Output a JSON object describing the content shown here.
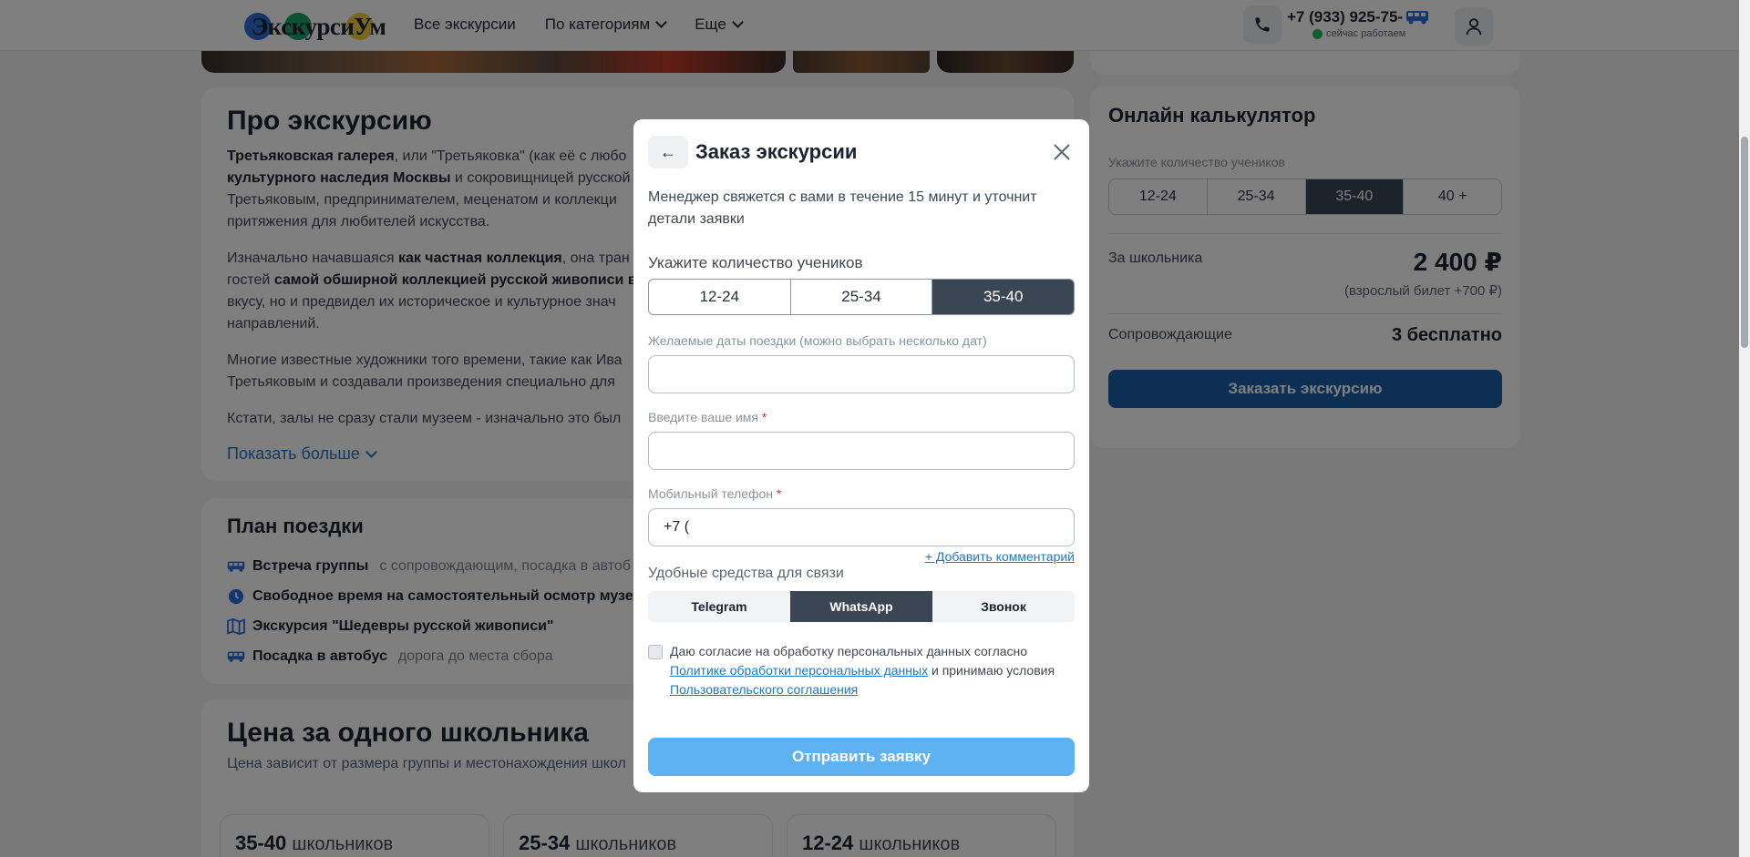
{
  "header": {
    "logo_text": "ЭкскурсиУм",
    "nav": [
      {
        "label": "Все экскурсии"
      },
      {
        "label": "По категориям"
      },
      {
        "label": "Еще"
      }
    ],
    "phone": "+7 (933) 925-75-",
    "status": "сейчас работаем"
  },
  "about": {
    "title": "Про экскурсию",
    "p1_bold": "Третьяковская галерея",
    "p1_a": ", или \"Третьяковка\" (как её с любо",
    "p1_bold2": "культурного наследия Москвы",
    "p1_b": " и сокровищницей русской",
    "p1_c": "Третьяковым, предпринимателем, меценатом и коллекци",
    "p1_d": "притяжения для любителей искусства.",
    "p2_a": "Изначально начавшаяся ",
    "p2_bold": "как частная коллекция",
    "p2_b": ", она тран",
    "p2_c": "гостей ",
    "p2_bold2": "самой обширной коллекцией русской живописи в",
    "p2_d": "вкусу, но и предвидел их историческое и культурное знач",
    "p2_e": "направлений.",
    "p3_a": "Многие известные художники того времени, такие как Ива",
    "p3_b": "Третьяковым и создавали произведения специально для",
    "p4": "Кстати, залы не сразу стали музеем - изначально это был",
    "show_more": "Показать  больше"
  },
  "plan": {
    "title": "План поездки",
    "rows": [
      {
        "title": "Встреча группы",
        "sub": "с сопровождающим, посадка в автоб"
      },
      {
        "title": "Свободное время на самостоятельный осмотр музе",
        "sub": ""
      },
      {
        "title": "Экскурсия \"Шедевры русской живописи\"",
        "sub": ""
      },
      {
        "title": "Посадка в автобус",
        "sub": "дорога до места сбора"
      }
    ]
  },
  "price": {
    "title": "Цена за одного школьника",
    "subtitle": "Цена зависит от размера группы и местонахождения школ",
    "tiers": [
      {
        "range": "35-40",
        "unit": "школьников"
      },
      {
        "range": "25-34",
        "unit": "школьников"
      },
      {
        "range": "12-24",
        "unit": "школьников"
      }
    ]
  },
  "calc": {
    "title": "Онлайн калькулятор",
    "label": "Укажите количество учеников",
    "options": [
      "12-24",
      "25-34",
      "35-40",
      "40 +"
    ],
    "per_student_label": "За школьника",
    "per_student_value": "2 400 ₽",
    "adult_note": "(взрослый билет +700 ₽)",
    "escort_label": "Сопровождающие",
    "escort_value": "3 бесплатно",
    "order_button": "Заказать экскурсию"
  },
  "modal": {
    "back": "←",
    "title": "Заказ экскурсии",
    "description": "Менеджер свяжется с вами в течение 15 минут и уточнит детали заявки",
    "count_label": "Укажите количество учеников",
    "count_options": [
      "12-24",
      "25-34",
      "35-40"
    ],
    "dates_label": "Желаемые даты поездки (можно выбрать несколько дат)",
    "dates_value": "",
    "name_label": "Введите ваше имя",
    "name_value": "",
    "phone_label": "Мобильный телефон",
    "phone_value": "+7 (",
    "required_mark": "*",
    "add_comment": "+ Добавить комментарий",
    "contact_label": "Удобные средства для связи",
    "contact_options": [
      "Telegram",
      "WhatsApp",
      "Звонок"
    ],
    "consent_a": "Даю согласие на обработку персональных данных согласно",
    "consent_link1": "Политике обработки персональных данных",
    "consent_b": " и принимаю условия",
    "consent_link2": "Пользовательского соглашения",
    "submit": "Отправить заявку"
  },
  "colors": {
    "accent": "#1b5ea8",
    "active_segment": "#3a4654",
    "submit": "#5eb2f2",
    "link": "#1d77c6",
    "status_green": "#2eb66d"
  }
}
